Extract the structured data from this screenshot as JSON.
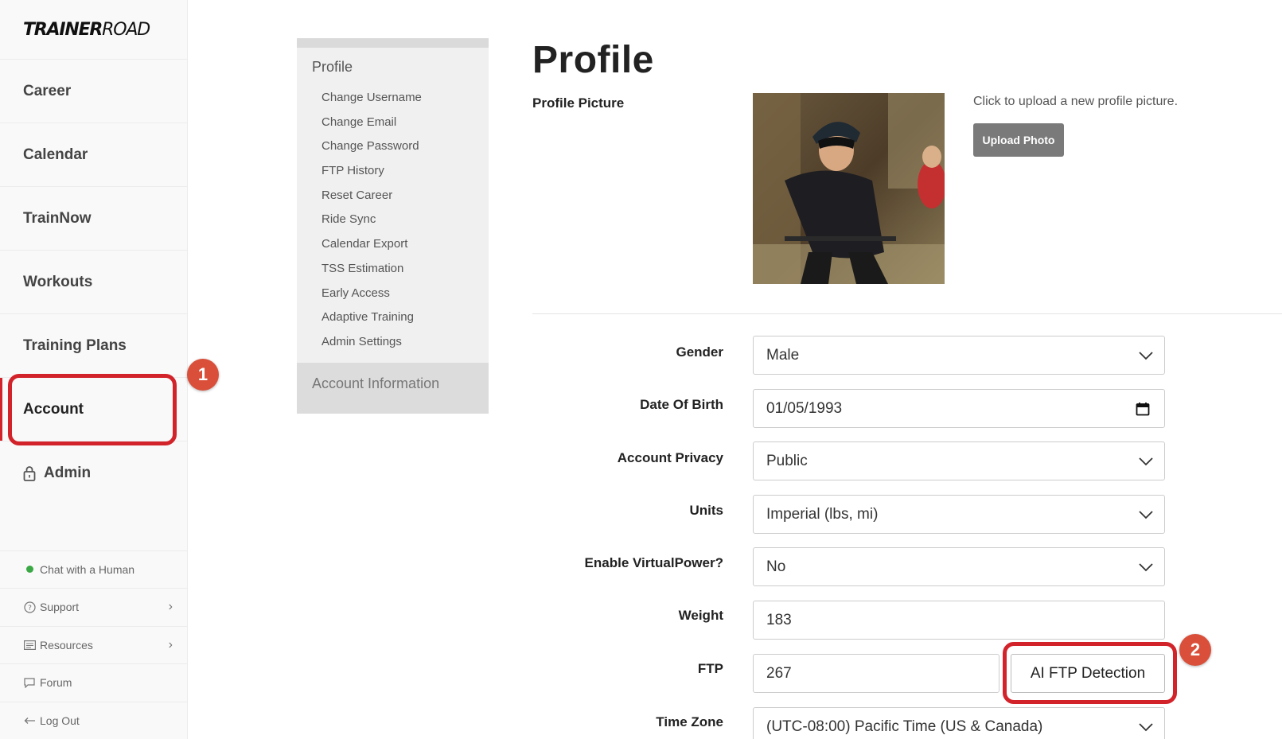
{
  "brand": {
    "logo_bold": "TRAINER",
    "logo_light": "ROAD"
  },
  "sidebar": {
    "items": [
      {
        "label": "Career"
      },
      {
        "label": "Calendar"
      },
      {
        "label": "TrainNow"
      },
      {
        "label": "Workouts"
      },
      {
        "label": "Training Plans"
      },
      {
        "label": "Account"
      },
      {
        "label": "Admin"
      }
    ],
    "bottom": [
      {
        "label": "Chat with a Human",
        "icon": "status-dot-icon"
      },
      {
        "label": "Support",
        "icon": "question-icon"
      },
      {
        "label": "Resources",
        "icon": "resources-icon"
      },
      {
        "label": "Forum",
        "icon": "chat-bubble-icon"
      },
      {
        "label": "Log Out",
        "icon": "arrow-left-icon"
      }
    ]
  },
  "callouts": {
    "one": "1",
    "two": "2"
  },
  "submenu": {
    "title": "Profile",
    "links": [
      "Change Username",
      "Change Email",
      "Change Password",
      "FTP History",
      "Reset Career",
      "Ride Sync",
      "Calendar Export",
      "TSS Estimation",
      "Early Access",
      "Adaptive Training",
      "Admin Settings"
    ],
    "account_info": "Account Information"
  },
  "main": {
    "title": "Profile",
    "profile_picture_label": "Profile Picture",
    "upload_hint": "Click to upload a new profile picture.",
    "upload_button": "Upload Photo",
    "fields": {
      "gender": {
        "label": "Gender",
        "value": "Male"
      },
      "dob": {
        "label": "Date Of Birth",
        "value": "01/05/1993"
      },
      "privacy": {
        "label": "Account Privacy",
        "value": "Public"
      },
      "units": {
        "label": "Units",
        "value": "Imperial (lbs, mi)"
      },
      "virtualpower": {
        "label": "Enable VirtualPower?",
        "value": "No"
      },
      "weight": {
        "label": "Weight",
        "value": "183"
      },
      "ftp": {
        "label": "FTP",
        "value": "267"
      },
      "timezone": {
        "label": "Time Zone",
        "value": "(UTC-08:00) Pacific Time (US & Canada)"
      }
    },
    "ai_ftp_button": "AI FTP Detection"
  },
  "colors": {
    "accent_red": "#d2232a",
    "badge": "#d94f3a",
    "online": "#3aa845"
  }
}
